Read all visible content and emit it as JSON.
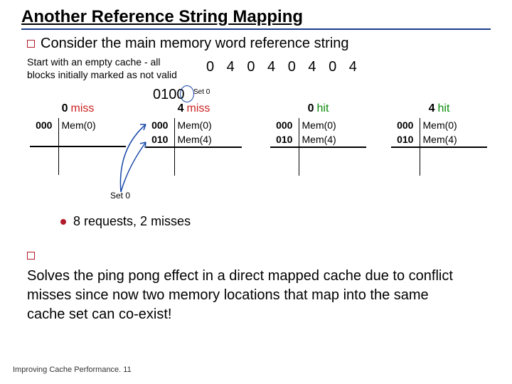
{
  "title": "Another Reference String Mapping",
  "line1": "Consider the main memory word reference string",
  "note": "Start with an empty cache - all blocks initially marked as not valid",
  "ref_string": "0  4  0  4  0  4  0  4",
  "binary": "0100",
  "set0_ann": "Set 0",
  "set0_lbl": "Set 0",
  "cols": [
    {
      "n": "0",
      "status": "miss",
      "cls": "red",
      "rows": [
        [
          "000",
          "Mem(0)"
        ],
        [
          "",
          ""
        ],
        [
          "",
          ""
        ],
        [
          "",
          ""
        ]
      ]
    },
    {
      "n": "4",
      "status": "miss",
      "cls": "red",
      "rows": [
        [
          "000",
          "Mem(0)"
        ],
        [
          "010",
          "Mem(4)"
        ],
        [
          "",
          ""
        ],
        [
          "",
          ""
        ]
      ]
    },
    {
      "n": "0",
      "status": "hit",
      "cls": "green",
      "rows": [
        [
          "000",
          "Mem(0)"
        ],
        [
          "010",
          "Mem(4)"
        ],
        [
          "",
          ""
        ],
        [
          "",
          ""
        ]
      ]
    },
    {
      "n": "4",
      "status": "hit",
      "cls": "green",
      "rows": [
        [
          "000",
          "Mem(0)"
        ],
        [
          "010",
          "Mem(4)"
        ],
        [
          "",
          ""
        ],
        [
          "",
          ""
        ]
      ]
    }
  ],
  "requests": "8 requests, 2 misses",
  "conclusion": "Solves the ping pong effect in a direct mapped cache due to conflict misses since now two memory locations that map into the same cache set can co-exist!",
  "footer": "Improving Cache Performance. 11",
  "chart_data": {
    "type": "table",
    "title": "Set-associative cache state after each reference",
    "reference_string": [
      0,
      4,
      0,
      4,
      0,
      4,
      0,
      4
    ],
    "steps": [
      {
        "ref": 0,
        "result": "miss",
        "set0": [
          {
            "tag": "000",
            "data": "Mem(0)"
          }
        ]
      },
      {
        "ref": 4,
        "result": "miss",
        "set0": [
          {
            "tag": "000",
            "data": "Mem(0)"
          },
          {
            "tag": "010",
            "data": "Mem(4)"
          }
        ]
      },
      {
        "ref": 0,
        "result": "hit",
        "set0": [
          {
            "tag": "000",
            "data": "Mem(0)"
          },
          {
            "tag": "010",
            "data": "Mem(4)"
          }
        ]
      },
      {
        "ref": 4,
        "result": "hit",
        "set0": [
          {
            "tag": "000",
            "data": "Mem(0)"
          },
          {
            "tag": "010",
            "data": "Mem(4)"
          }
        ]
      }
    ],
    "summary": {
      "requests": 8,
      "misses": 2
    }
  }
}
